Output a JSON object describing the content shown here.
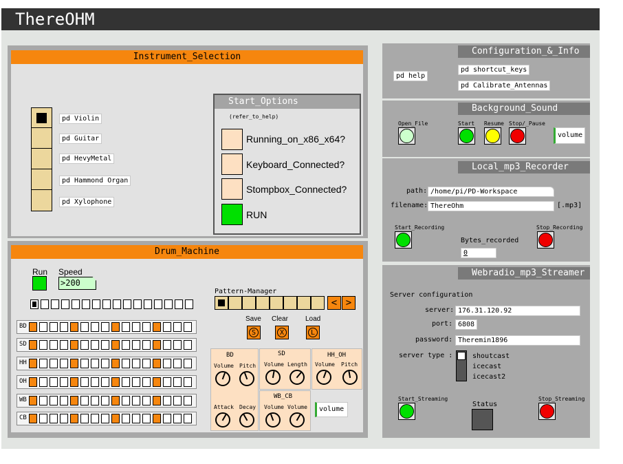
{
  "app": {
    "title": "ThereOHM"
  },
  "instrument": {
    "header": "Instrument_Selection",
    "items": [
      "pd Violin",
      "pd Guitar",
      "pd HevyMetal",
      "pd Hammond Organ",
      "pd Xylophone"
    ],
    "selected_index": 0
  },
  "start_options": {
    "header": "Start_Options",
    "hint": "(refer_to_help)",
    "options": [
      "Running_on_x86_x64?",
      "Keyboard_Connected?",
      "Stompbox_Connected?"
    ],
    "run_label": "RUN"
  },
  "drum": {
    "header": "Drum_Machine",
    "run_label": "Run",
    "speed_label": "Speed",
    "speed_value": "200",
    "tracks": [
      "BD",
      "SD",
      "HH",
      "OH",
      "WB",
      "CB"
    ],
    "pattern_manager_label": "Pattern-Manager",
    "save_label": "Save",
    "clear_label": "Clear",
    "load_label": "Load",
    "save_glyph": "S",
    "clear_glyph": "X",
    "load_glyph": "L",
    "bd_label": "BD",
    "sd_label": "SD",
    "hh_oh_label": "HH_OH",
    "wb_cb_label": "WB_CB",
    "volume_label": "Volume",
    "pitch_label": "Pitch",
    "length_label": "Length",
    "attack_label": "Attack",
    "decay_label": "Decay",
    "volume_button": "volume"
  },
  "config": {
    "header": "Configuration_&_Info",
    "help": "pd help",
    "shortcut_keys": "pd shortcut_keys",
    "calibrate": "pd Calibrate_Antennas"
  },
  "background_sound": {
    "header": "Background_Sound",
    "open_file": "Open_File",
    "start": "Start",
    "resume": "Resume",
    "stop_pause": "Stop/_Pause",
    "volume": "volume"
  },
  "recorder": {
    "header": "Local_mp3_Recorder",
    "path_label": "path:",
    "path_value": "/home/pi/PD-Workspace",
    "filename_label": "filename:",
    "filename_value": "ThereOhm",
    "ext": "[.mp3]",
    "start_recording": "Start_Recording",
    "stop_recording": "Stop_Recording",
    "bytes_label": "Bytes_recorded",
    "bytes_value": "0"
  },
  "streamer": {
    "header": "Webradio_mp3_Streamer",
    "server_config": "Server configuration",
    "server_label": "server:",
    "server_value": "176.31.120.92",
    "port_label": "port:",
    "port_value": "6808",
    "password_label": "password:",
    "password_value": "Theremin1896",
    "server_type_label": "server type :",
    "server_types": [
      "shoutcast",
      "icecast",
      "icecast2"
    ],
    "start_streaming": "Start_Streaming",
    "status": "Status",
    "stop_streaming": "Stop_Streaming"
  },
  "colors": {
    "orange": "#f6860e",
    "green": "#00e000",
    "yellow": "#ffff00",
    "red": "#f00000",
    "peach": "#fde0c2",
    "toggle": "#ecd79d"
  }
}
